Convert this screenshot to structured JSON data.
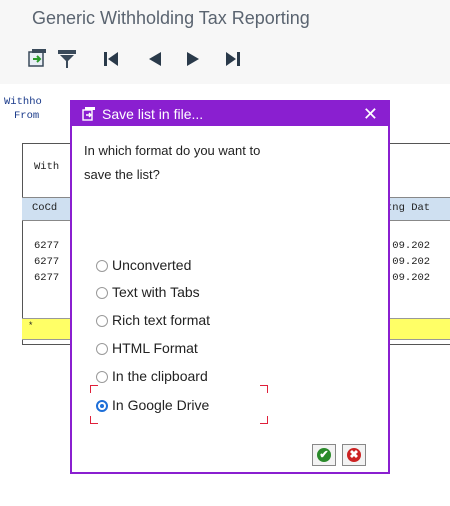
{
  "app": {
    "title": "Generic Withholding Tax Reporting"
  },
  "toolbar": {
    "icons": [
      "export-icon",
      "filter-icon",
      "first-page-icon",
      "previous-page-icon",
      "next-page-icon",
      "last-page-icon"
    ]
  },
  "report": {
    "header_line1": "Withho",
    "header_line2": "From",
    "grid_title": "With",
    "col_left": "CoCd",
    "col_right": "tng Dat",
    "rows_left": [
      "6277",
      "6277",
      "6277"
    ],
    "rows_right": [
      ".09.202",
      ".09.202",
      ".09.202"
    ],
    "total_marker": "*",
    "colors": {
      "header_bg": "#cfe0f1",
      "total_bg": "#ffff66"
    }
  },
  "dialog": {
    "title": "Save list in file...",
    "close_glyph": "✕",
    "question_line1": "In which format do you want to",
    "question_line2": "save the list?",
    "options": [
      {
        "label": "Unconverted",
        "selected": false
      },
      {
        "label": "Text with Tabs",
        "selected": false
      },
      {
        "label": "Rich text format",
        "selected": false
      },
      {
        "label": "HTML Format",
        "selected": false
      },
      {
        "label": "In the clipboard",
        "selected": false
      },
      {
        "label": "In Google Drive",
        "selected": true
      }
    ],
    "confirm_glyph": "✔",
    "cancel_glyph": "✖",
    "colors": {
      "frame": "#8a1fd0",
      "confirm": "#2a8a2a",
      "cancel": "#cc2222",
      "radio_selected": "#1e6fd8",
      "focus": "#e0203a"
    }
  }
}
